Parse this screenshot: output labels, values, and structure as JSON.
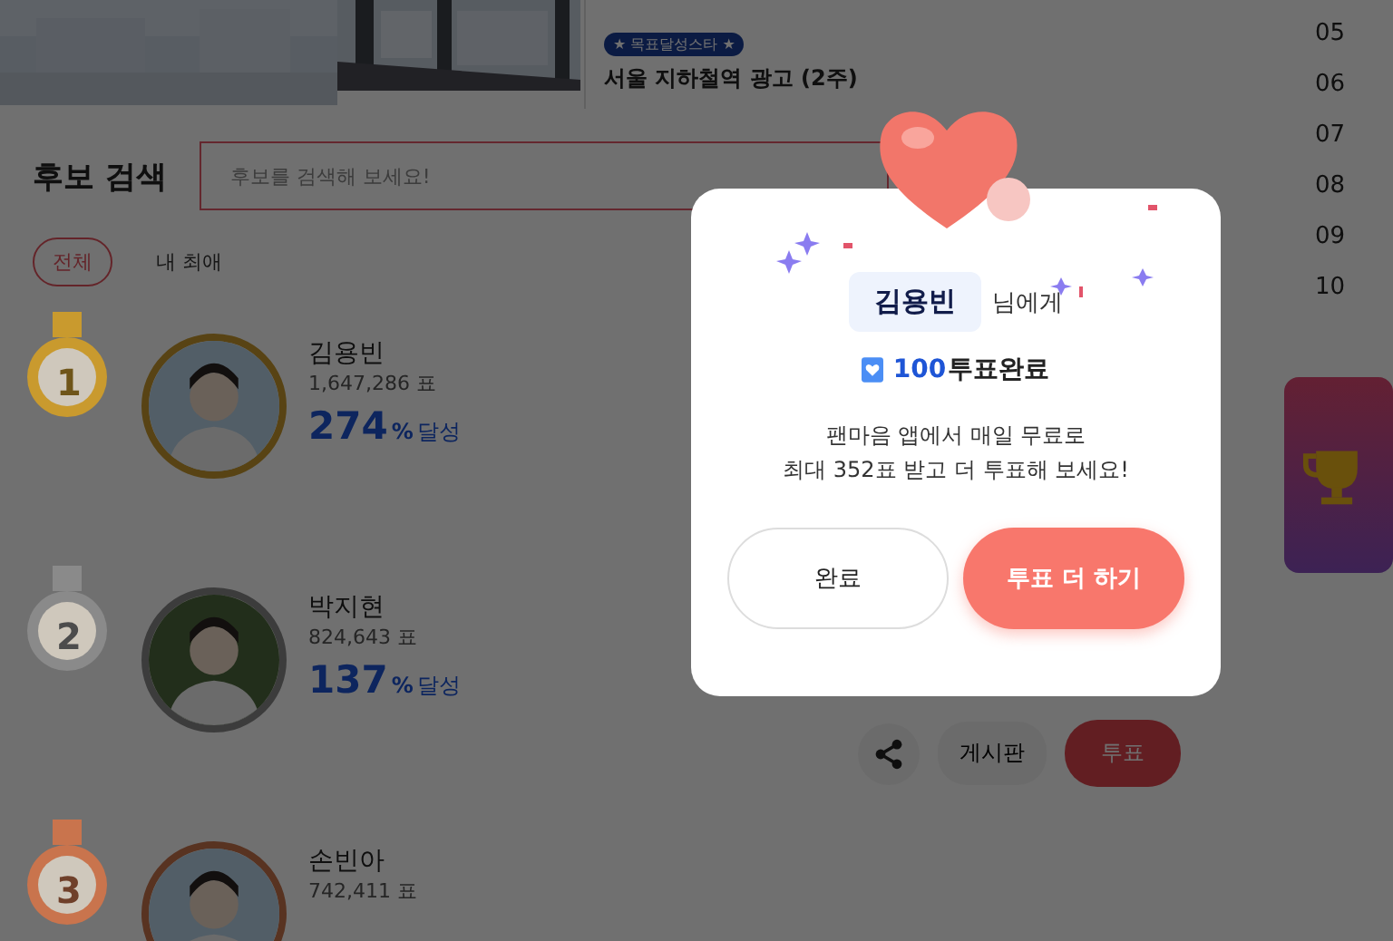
{
  "banner": {
    "badge": "★ 목표달성스타 ★",
    "title": "서울 지하철역 광고 (2주)"
  },
  "rank_numbers": [
    "05",
    "06",
    "07",
    "08",
    "09",
    "10"
  ],
  "search": {
    "label": "후보 검색",
    "placeholder": "후보를 검색해 보세요!"
  },
  "filters": [
    {
      "label": "전체",
      "selected": true
    },
    {
      "label": "내 최애",
      "selected": false
    }
  ],
  "candidates": [
    {
      "rank": "1",
      "color": "#c99a2e",
      "name": "김용빈",
      "votes": "1,647,286 표",
      "percent": "274",
      "percent_unit": "%",
      "achieved": "달성"
    },
    {
      "rank": "2",
      "color": "#8a8a8a",
      "name": "박지현",
      "votes": "824,643 표",
      "percent": "137",
      "percent_unit": "%",
      "achieved": "달성"
    },
    {
      "rank": "3",
      "color": "#c9744d",
      "name": "손빈아",
      "votes": "742,411 표"
    }
  ],
  "actions": {
    "board": "게시판",
    "vote": "투표"
  },
  "modal": {
    "recipient": "김용빈",
    "recipient_suffix": "님에게",
    "vote_count": "100",
    "vote_status": "투표완료",
    "message": [
      "팬마음 앱에서 매일 무료로",
      "최대 352표 받고 더 투표해 보세요!"
    ],
    "buttons": [
      {
        "label": "완료",
        "kind": "secondary"
      },
      {
        "label": "투표 더 하기",
        "kind": "primary"
      }
    ]
  }
}
